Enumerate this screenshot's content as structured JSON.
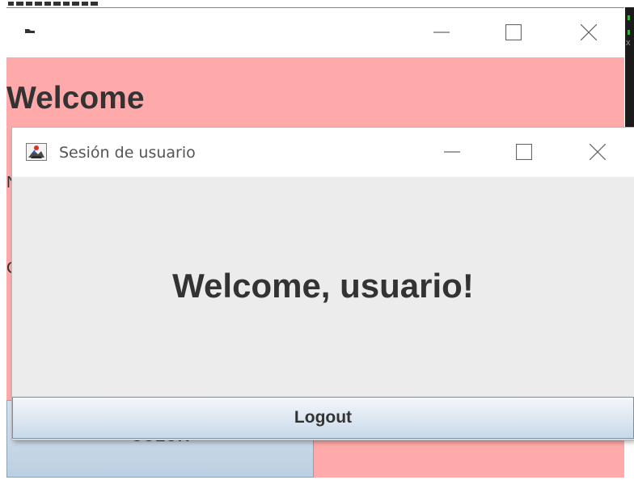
{
  "background_window": {
    "heading": "Welcome",
    "color_button_label": "COLOR",
    "left_letters": [
      "N",
      "C"
    ],
    "background_color": "#ffaaaa"
  },
  "dialog": {
    "title": "Sesión de usuario",
    "message": "Welcome, usuario!",
    "logout_label": "Logout"
  },
  "right_edge": {
    "close_glyph": "x"
  }
}
